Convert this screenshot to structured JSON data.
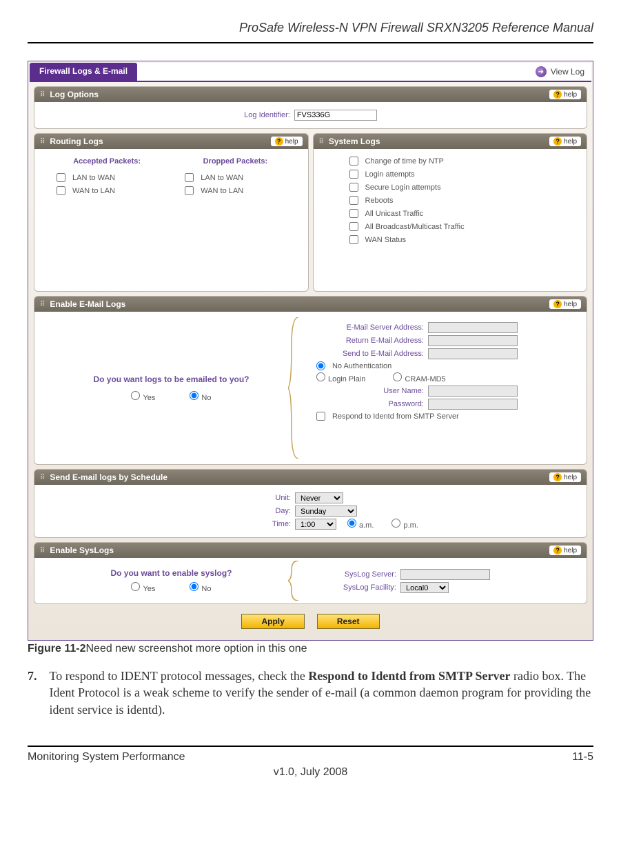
{
  "doc_header": "ProSafe Wireless-N VPN Firewall SRXN3205 Reference Manual",
  "tab_title": "Firewall Logs & E-mail",
  "view_log_label": "View Log",
  "help_label": "help",
  "panels": {
    "log_options": {
      "title": "Log Options",
      "field_label": "Log Identifier:",
      "field_value": "FVS336G"
    },
    "routing_logs": {
      "title": "Routing Logs",
      "col1_header": "Accepted Packets:",
      "col2_header": "Dropped Packets:",
      "items": [
        "LAN to WAN",
        "WAN to LAN"
      ]
    },
    "system_logs": {
      "title": "System Logs",
      "items": [
        "Change of time by NTP",
        "Login attempts",
        "Secure Login attempts",
        "Reboots",
        "All Unicast Traffic",
        "All Broadcast/Multicast Traffic",
        "WAN Status"
      ]
    },
    "email_logs": {
      "title": "Enable E-Mail Logs",
      "question": "Do you want logs to be emailed to you?",
      "yes": "Yes",
      "no": "No",
      "server_label": "E-Mail Server Address:",
      "return_label": "Return E-Mail Address:",
      "sendto_label": "Send to E-Mail Address:",
      "no_auth": "No Authentication",
      "login_plain": "Login Plain",
      "cram_md5": "CRAM-MD5",
      "user_label": "User Name:",
      "pass_label": "Password:",
      "identd": "Respond to Identd from SMTP Server"
    },
    "schedule": {
      "title": "Send E-mail logs by Schedule",
      "unit_label": "Unit:",
      "unit_value": "Never",
      "day_label": "Day:",
      "day_value": "Sunday",
      "time_label": "Time:",
      "time_value": "1:00",
      "am": "a.m.",
      "pm": "p.m."
    },
    "syslogs": {
      "title": "Enable SysLogs",
      "question": "Do you want to enable syslog?",
      "yes": "Yes",
      "no": "No",
      "server_label": "SysLog Server:",
      "facility_label": "SysLog Facility:",
      "facility_value": "Local0"
    }
  },
  "buttons": {
    "apply": "Apply",
    "reset": "Reset"
  },
  "figure_caption_bold": "Figure 11-2",
  "figure_caption_rest": "Need new screenshot more option in this one",
  "step_num": "7.",
  "step_text_1": "To respond to IDENT protocol messages, check the ",
  "step_bold": "Respond to Identd from SMTP Server",
  "step_text_2": " radio box. The Ident Protocol is a weak scheme to verify the sender of e-mail (a common daemon program for providing the ident service is identd).",
  "footer_left": "Monitoring System Performance",
  "footer_right": "11-5",
  "footer_center": "v1.0, July 2008"
}
